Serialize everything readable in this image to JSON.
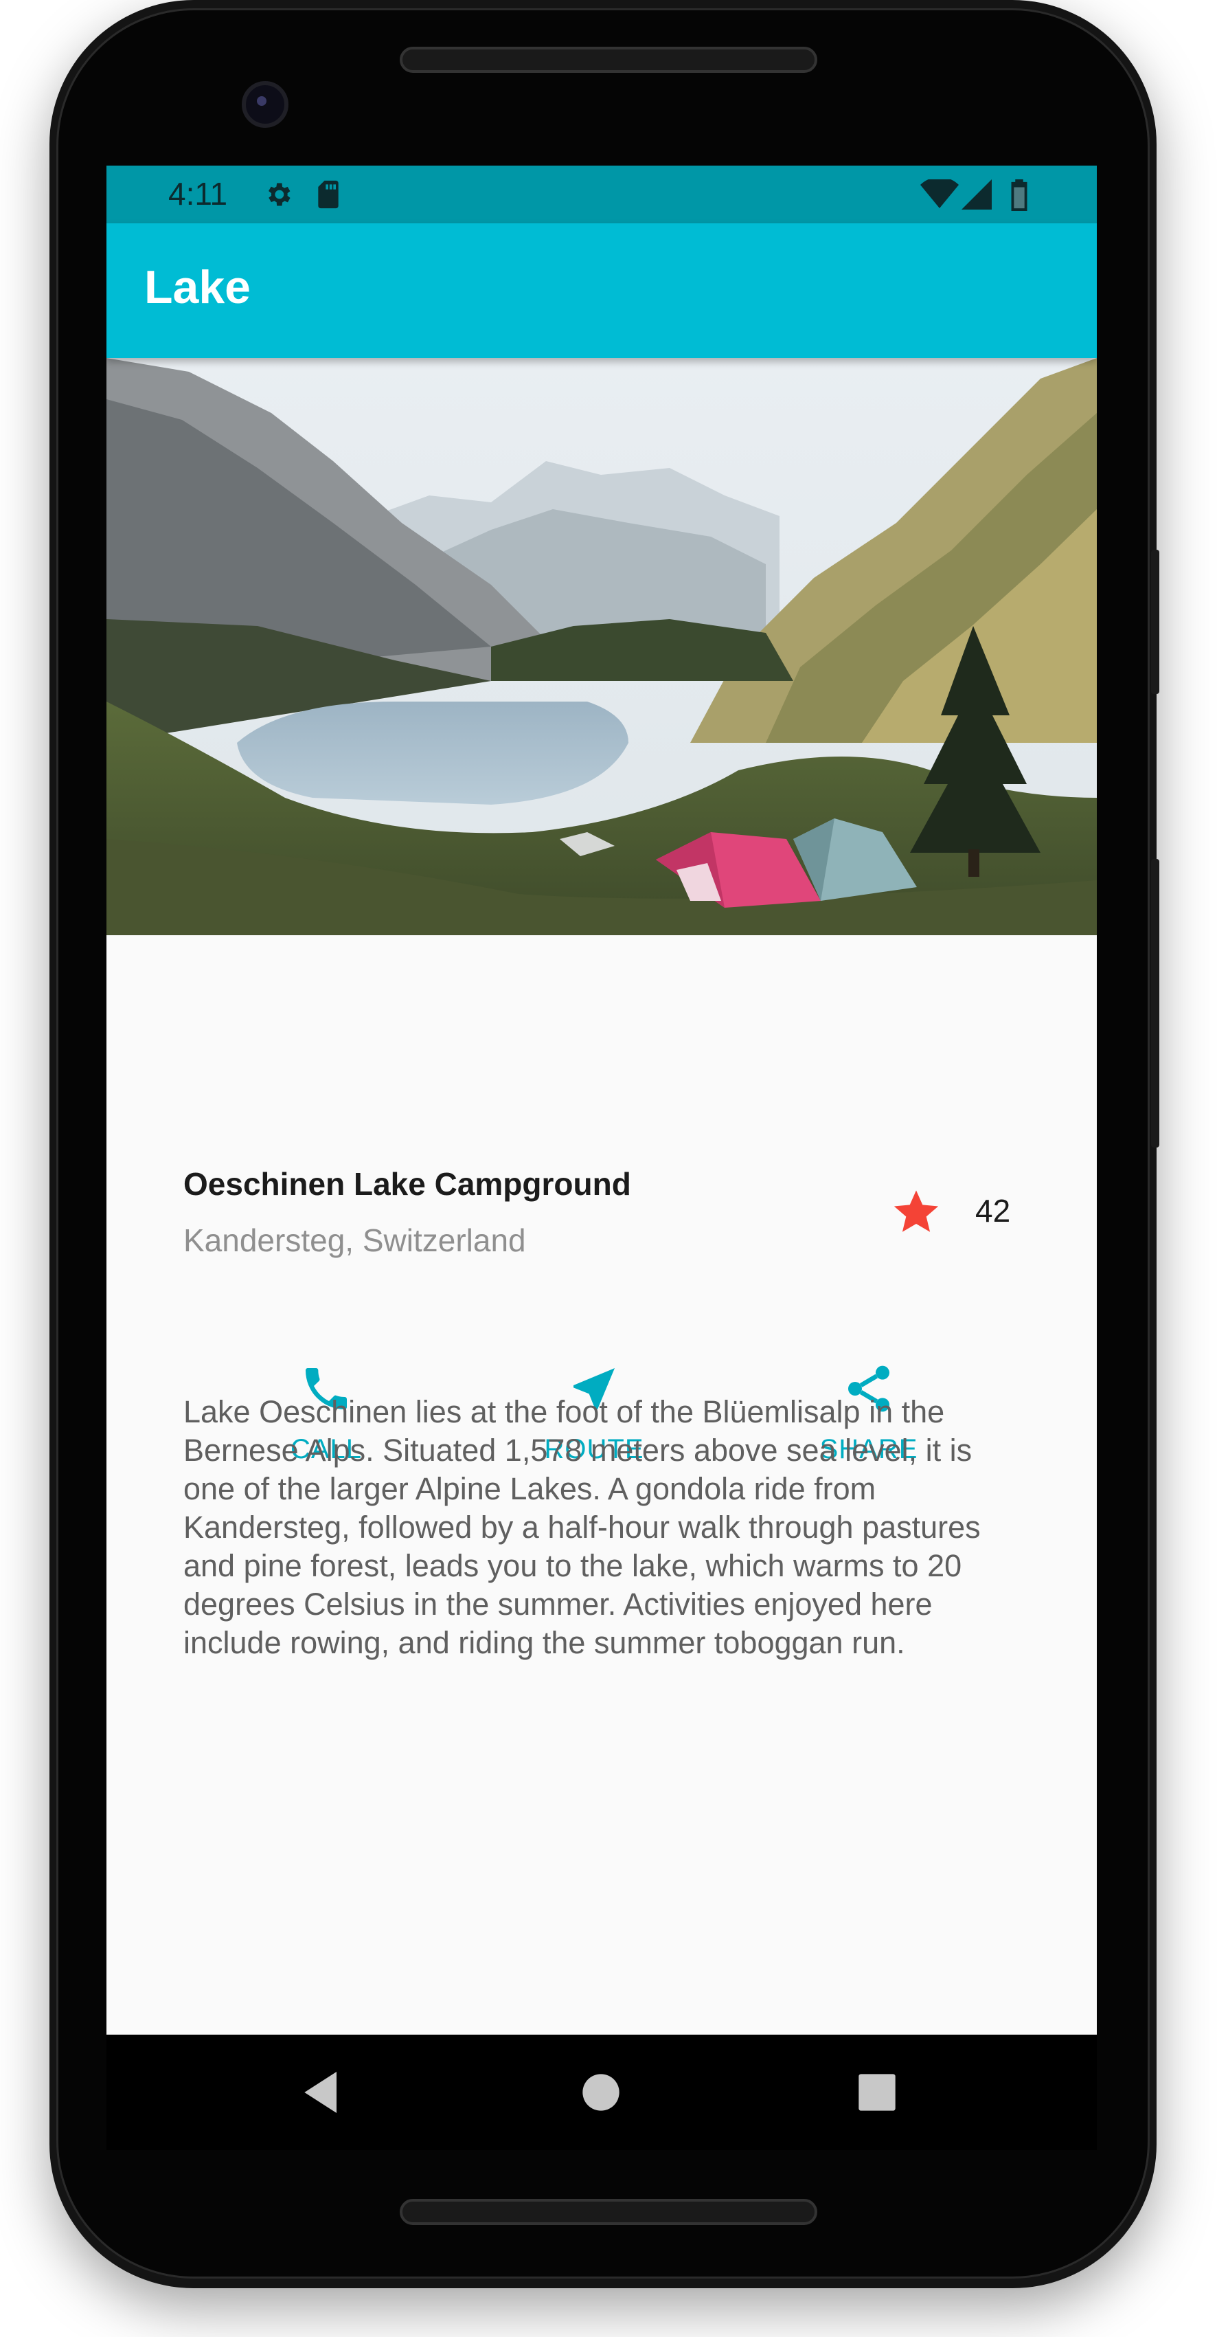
{
  "status_bar": {
    "time": "4:11",
    "icons": [
      "gear-icon",
      "sd-card-icon",
      "wifi-icon",
      "signal-icon",
      "battery-icon"
    ]
  },
  "app_bar": {
    "title": "Lake"
  },
  "hero_image": {
    "subject": "mountain-lake-campground-photo"
  },
  "place": {
    "name": "Oeschinen Lake Campground",
    "location": "Kandersteg, Switzerland",
    "rating_count": "42",
    "rating_icon": "star-icon"
  },
  "actions": [
    {
      "label": "CALL",
      "icon": "phone-icon"
    },
    {
      "label": "ROUTE",
      "icon": "navigation-icon"
    },
    {
      "label": "SHARE",
      "icon": "share-icon"
    }
  ],
  "description": "Lake Oeschinen lies at the foot of the Blüemlisalp in the Bernese Alps. Situated 1,578 meters above sea level, it is one of the larger Alpine Lakes. A gondola ride from Kandersteg, followed by a half-hour walk through pastures and pine forest, leads you to the lake, which warms to 20 degrees Celsius in the summer. Activities enjoyed here include rowing, and riding the summer toboggan run.",
  "nav_bar": {
    "buttons": [
      "back-icon",
      "home-icon",
      "recents-icon"
    ]
  },
  "colors": {
    "primary": "#00bcd4",
    "primary_dark": "#0097a7",
    "accent": "#00acc1",
    "star": "#f44336",
    "background": "#fafafa"
  }
}
